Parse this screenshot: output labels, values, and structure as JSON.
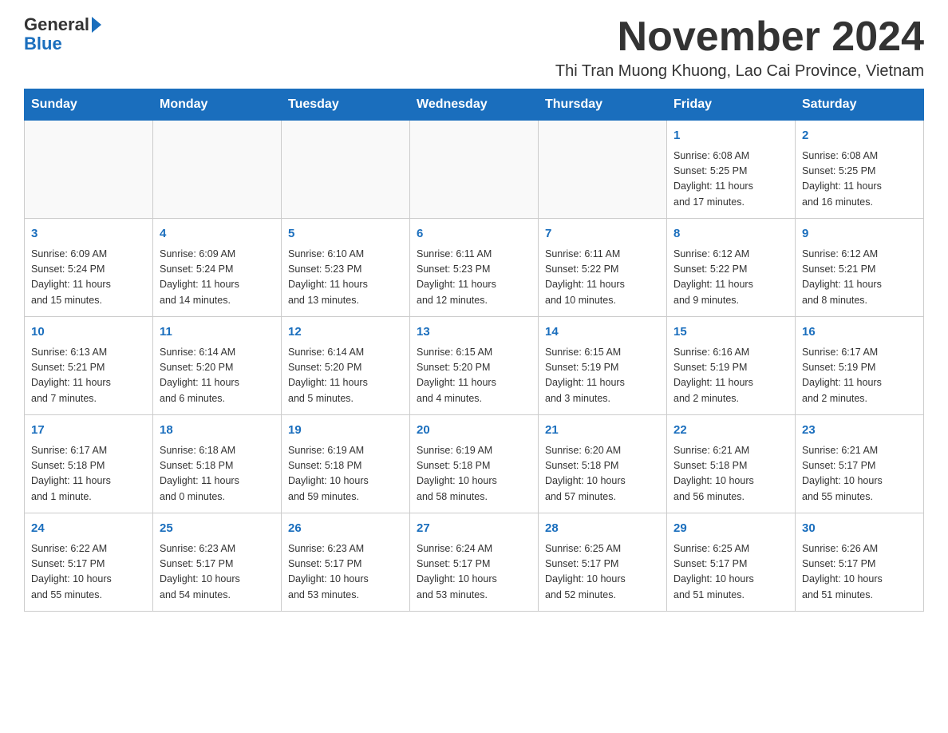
{
  "header": {
    "logo_general": "General",
    "logo_blue": "Blue",
    "month_title": "November 2024",
    "location": "Thi Tran Muong Khuong, Lao Cai Province, Vietnam"
  },
  "weekdays": [
    "Sunday",
    "Monday",
    "Tuesday",
    "Wednesday",
    "Thursday",
    "Friday",
    "Saturday"
  ],
  "weeks": [
    [
      {
        "day": "",
        "info": ""
      },
      {
        "day": "",
        "info": ""
      },
      {
        "day": "",
        "info": ""
      },
      {
        "day": "",
        "info": ""
      },
      {
        "day": "",
        "info": ""
      },
      {
        "day": "1",
        "info": "Sunrise: 6:08 AM\nSunset: 5:25 PM\nDaylight: 11 hours\nand 17 minutes."
      },
      {
        "day": "2",
        "info": "Sunrise: 6:08 AM\nSunset: 5:25 PM\nDaylight: 11 hours\nand 16 minutes."
      }
    ],
    [
      {
        "day": "3",
        "info": "Sunrise: 6:09 AM\nSunset: 5:24 PM\nDaylight: 11 hours\nand 15 minutes."
      },
      {
        "day": "4",
        "info": "Sunrise: 6:09 AM\nSunset: 5:24 PM\nDaylight: 11 hours\nand 14 minutes."
      },
      {
        "day": "5",
        "info": "Sunrise: 6:10 AM\nSunset: 5:23 PM\nDaylight: 11 hours\nand 13 minutes."
      },
      {
        "day": "6",
        "info": "Sunrise: 6:11 AM\nSunset: 5:23 PM\nDaylight: 11 hours\nand 12 minutes."
      },
      {
        "day": "7",
        "info": "Sunrise: 6:11 AM\nSunset: 5:22 PM\nDaylight: 11 hours\nand 10 minutes."
      },
      {
        "day": "8",
        "info": "Sunrise: 6:12 AM\nSunset: 5:22 PM\nDaylight: 11 hours\nand 9 minutes."
      },
      {
        "day": "9",
        "info": "Sunrise: 6:12 AM\nSunset: 5:21 PM\nDaylight: 11 hours\nand 8 minutes."
      }
    ],
    [
      {
        "day": "10",
        "info": "Sunrise: 6:13 AM\nSunset: 5:21 PM\nDaylight: 11 hours\nand 7 minutes."
      },
      {
        "day": "11",
        "info": "Sunrise: 6:14 AM\nSunset: 5:20 PM\nDaylight: 11 hours\nand 6 minutes."
      },
      {
        "day": "12",
        "info": "Sunrise: 6:14 AM\nSunset: 5:20 PM\nDaylight: 11 hours\nand 5 minutes."
      },
      {
        "day": "13",
        "info": "Sunrise: 6:15 AM\nSunset: 5:20 PM\nDaylight: 11 hours\nand 4 minutes."
      },
      {
        "day": "14",
        "info": "Sunrise: 6:15 AM\nSunset: 5:19 PM\nDaylight: 11 hours\nand 3 minutes."
      },
      {
        "day": "15",
        "info": "Sunrise: 6:16 AM\nSunset: 5:19 PM\nDaylight: 11 hours\nand 2 minutes."
      },
      {
        "day": "16",
        "info": "Sunrise: 6:17 AM\nSunset: 5:19 PM\nDaylight: 11 hours\nand 2 minutes."
      }
    ],
    [
      {
        "day": "17",
        "info": "Sunrise: 6:17 AM\nSunset: 5:18 PM\nDaylight: 11 hours\nand 1 minute."
      },
      {
        "day": "18",
        "info": "Sunrise: 6:18 AM\nSunset: 5:18 PM\nDaylight: 11 hours\nand 0 minutes."
      },
      {
        "day": "19",
        "info": "Sunrise: 6:19 AM\nSunset: 5:18 PM\nDaylight: 10 hours\nand 59 minutes."
      },
      {
        "day": "20",
        "info": "Sunrise: 6:19 AM\nSunset: 5:18 PM\nDaylight: 10 hours\nand 58 minutes."
      },
      {
        "day": "21",
        "info": "Sunrise: 6:20 AM\nSunset: 5:18 PM\nDaylight: 10 hours\nand 57 minutes."
      },
      {
        "day": "22",
        "info": "Sunrise: 6:21 AM\nSunset: 5:18 PM\nDaylight: 10 hours\nand 56 minutes."
      },
      {
        "day": "23",
        "info": "Sunrise: 6:21 AM\nSunset: 5:17 PM\nDaylight: 10 hours\nand 55 minutes."
      }
    ],
    [
      {
        "day": "24",
        "info": "Sunrise: 6:22 AM\nSunset: 5:17 PM\nDaylight: 10 hours\nand 55 minutes."
      },
      {
        "day": "25",
        "info": "Sunrise: 6:23 AM\nSunset: 5:17 PM\nDaylight: 10 hours\nand 54 minutes."
      },
      {
        "day": "26",
        "info": "Sunrise: 6:23 AM\nSunset: 5:17 PM\nDaylight: 10 hours\nand 53 minutes."
      },
      {
        "day": "27",
        "info": "Sunrise: 6:24 AM\nSunset: 5:17 PM\nDaylight: 10 hours\nand 53 minutes."
      },
      {
        "day": "28",
        "info": "Sunrise: 6:25 AM\nSunset: 5:17 PM\nDaylight: 10 hours\nand 52 minutes."
      },
      {
        "day": "29",
        "info": "Sunrise: 6:25 AM\nSunset: 5:17 PM\nDaylight: 10 hours\nand 51 minutes."
      },
      {
        "day": "30",
        "info": "Sunrise: 6:26 AM\nSunset: 5:17 PM\nDaylight: 10 hours\nand 51 minutes."
      }
    ]
  ]
}
